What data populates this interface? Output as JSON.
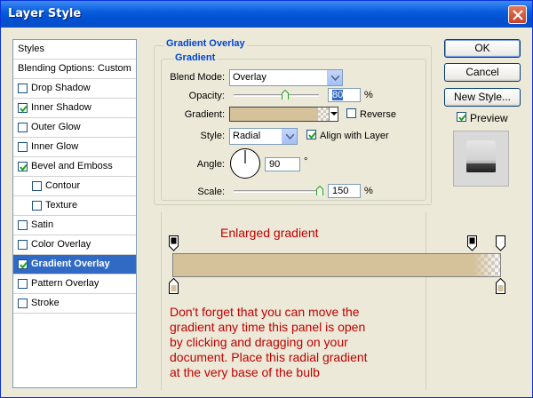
{
  "window": {
    "title": "Layer Style"
  },
  "styles_list": {
    "items": [
      {
        "label": "Styles"
      },
      {
        "label": "Blending Options: Custom"
      },
      {
        "label": "Drop Shadow",
        "checked": false
      },
      {
        "label": "Inner Shadow",
        "checked": true
      },
      {
        "label": "Outer Glow",
        "checked": false
      },
      {
        "label": "Inner Glow",
        "checked": false
      },
      {
        "label": "Bevel and Emboss",
        "checked": true
      },
      {
        "label": "Contour",
        "checked": false
      },
      {
        "label": "Texture",
        "checked": false
      },
      {
        "label": "Satin",
        "checked": false
      },
      {
        "label": "Color Overlay",
        "checked": false
      },
      {
        "label": "Gradient Overlay",
        "checked": true,
        "selected": true
      },
      {
        "label": "Pattern Overlay",
        "checked": false
      },
      {
        "label": "Stroke",
        "checked": false
      }
    ]
  },
  "panel": {
    "outer_legend": "Gradient Overlay",
    "inner_legend": "Gradient",
    "blend_mode": {
      "label": "Blend Mode:",
      "value": "Overlay"
    },
    "opacity": {
      "label": "Opacity:",
      "value": "80",
      "unit": "%",
      "slider_fraction": 0.8
    },
    "gradient": {
      "label": "Gradient:",
      "reverse_label": "Reverse",
      "reverse_checked": false,
      "color": "#d5c29a"
    },
    "style": {
      "label": "Style:",
      "value": "Radial",
      "align_label": "Align with Layer",
      "align_checked": true
    },
    "angle": {
      "label": "Angle:",
      "value": "90",
      "unit": "°"
    },
    "scale": {
      "label": "Scale:",
      "value": "150",
      "unit": "%",
      "slider_fraction": 1.0
    }
  },
  "buttons": {
    "ok": "OK",
    "cancel": "Cancel",
    "new_style": "New Style...",
    "preview_label": "Preview",
    "preview_checked": true
  },
  "annotations": {
    "enlarged": "Enlarged gradient",
    "note_lines": [
      "Don't forget that you can move the",
      "gradient any time this panel is open",
      "by clicking and dragging on your",
      "document. Place this radial gradient",
      "at the very base of the bulb"
    ]
  },
  "colors": {
    "accent": "#0046d5",
    "selection": "#316ac5",
    "annotation_text": "#c00000",
    "gradient_color": "#d5c29a"
  }
}
